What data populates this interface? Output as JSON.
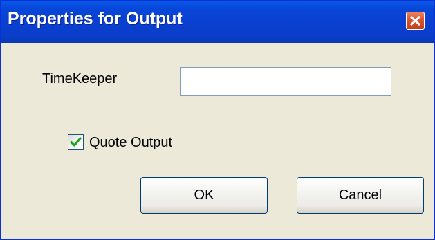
{
  "window": {
    "title": "Properties for Output",
    "close_icon": "close-icon",
    "title_color": "#0a3fd0"
  },
  "form": {
    "timekeeper_label": "TimeKeeper",
    "timekeeper_value": "",
    "quote_output_label": "Quote Output",
    "quote_output_checked": true
  },
  "buttons": {
    "ok_label": "OK",
    "cancel_label": "Cancel"
  }
}
